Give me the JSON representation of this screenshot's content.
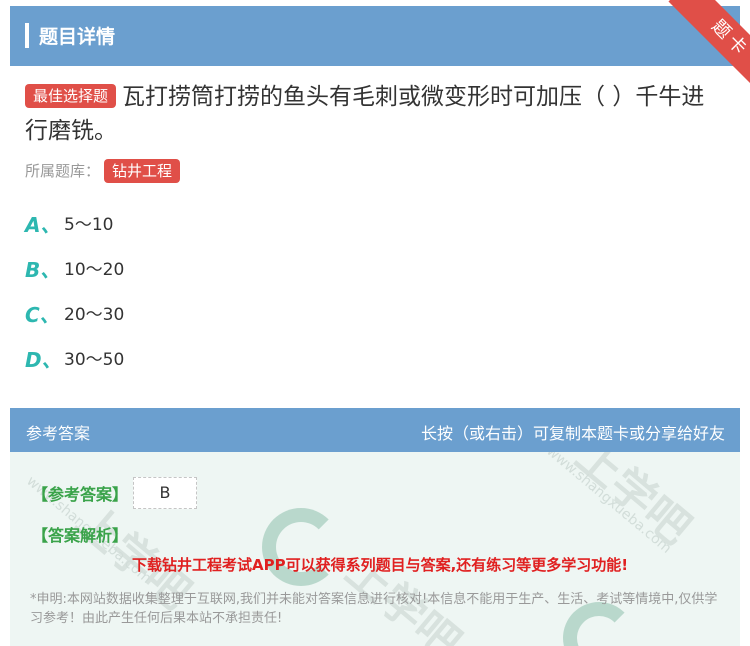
{
  "header": {
    "title": "题目详情",
    "ribbon": "题卡"
  },
  "question": {
    "tag": "最佳选择题",
    "text": "瓦打捞筒打捞的鱼头有毛刺或微变形时可加压（ ）千牛进行磨铣。",
    "bank_label": "所属题库：",
    "bank_name": "钻井工程"
  },
  "options": [
    {
      "letter": "A、",
      "text": "5～10"
    },
    {
      "letter": "B、",
      "text": "10～20"
    },
    {
      "letter": "C、",
      "text": "20～30"
    },
    {
      "letter": "D、",
      "text": "30～50"
    }
  ],
  "answer_bar": {
    "left": "参考答案",
    "right": "长按（或右击）可复制本题卡或分享给好友"
  },
  "answer": {
    "ref_label": "【参考答案】",
    "ref_value": "B",
    "analysis_label": "【答案解析】",
    "promo": "下载钻井工程考试APP可以获得系列题目与答案,还有练习等更多学习功能!",
    "disclaimer": "*申明:本网站数据收集整理于互联网,我们并未能对答案信息进行核对!本信息不能用于生产、生活、考试等情境中,仅供学习参考！由此产生任何后果本站不承担责任!"
  },
  "watermark": {
    "text1": "上学吧",
    "text2": "www.shangxueba.com"
  },
  "colors": {
    "header": "#6b9fcf",
    "accent_red": "#e04f48",
    "option_letter": "#2db7b0",
    "green_label": "#3aa34a"
  }
}
